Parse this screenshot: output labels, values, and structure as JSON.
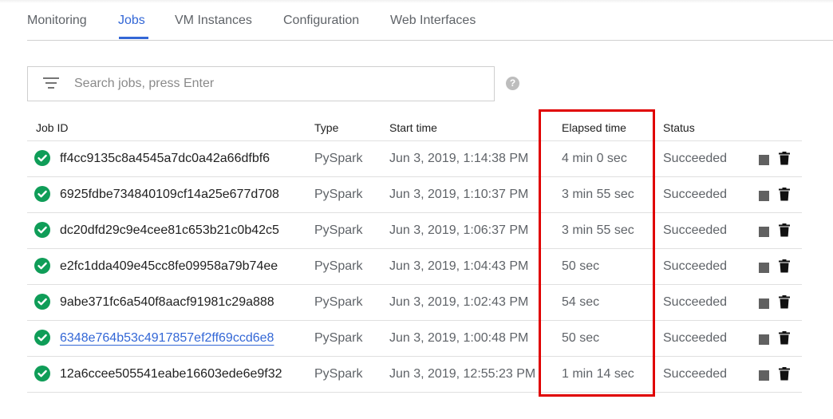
{
  "tabs": [
    {
      "label": "Monitoring",
      "active": false
    },
    {
      "label": "Jobs",
      "active": true
    },
    {
      "label": "VM Instances",
      "active": false
    },
    {
      "label": "Configuration",
      "active": false
    },
    {
      "label": "Web Interfaces",
      "active": false
    }
  ],
  "search": {
    "placeholder": "Search jobs, press Enter",
    "value": ""
  },
  "help_icon_glyph": "?",
  "columns": {
    "job_id": "Job ID",
    "type": "Type",
    "start_time": "Start time",
    "elapsed_time": "Elapsed time",
    "status": "Status"
  },
  "jobs": [
    {
      "id": "ff4cc9135c8a4545a7dc0a42a66dfbf6",
      "type": "PySpark",
      "start": "Jun 3, 2019, 1:14:38 PM",
      "elapsed": "4 min 0 sec",
      "status": "Succeeded"
    },
    {
      "id": "6925fdbe734840109cf14a25e677d708",
      "type": "PySpark",
      "start": "Jun 3, 2019, 1:10:37 PM",
      "elapsed": "3 min 55 sec",
      "status": "Succeeded"
    },
    {
      "id": "dc20dfd29c9e4cee81c653b21c0b42c5",
      "type": "PySpark",
      "start": "Jun 3, 2019, 1:06:37 PM",
      "elapsed": "3 min 55 sec",
      "status": "Succeeded"
    },
    {
      "id": "e2fc1dda409e45cc8fe09958a79b74ee",
      "type": "PySpark",
      "start": "Jun 3, 2019, 1:04:43 PM",
      "elapsed": "50 sec",
      "status": "Succeeded"
    },
    {
      "id": "9abe371fc6a540f8aacf91981c29a888",
      "type": "PySpark",
      "start": "Jun 3, 2019, 1:02:43 PM",
      "elapsed": "54 sec",
      "status": "Succeeded"
    },
    {
      "id": "6348e764b53c4917857ef2ff69ccd6e8",
      "type": "PySpark",
      "start": "Jun 3, 2019, 1:00:48 PM",
      "elapsed": "50 sec",
      "status": "Succeeded",
      "hovered_link": true
    },
    {
      "id": "12a6ccee505541eabe16603ede6e9f32",
      "type": "PySpark",
      "start": "Jun 3, 2019, 12:55:23 PM",
      "elapsed": "1 min 14 sec",
      "status": "Succeeded"
    }
  ],
  "colors": {
    "accent": "#3367d6",
    "success": "#0f9d58",
    "highlight": "#e00000"
  },
  "row_icons": [
    "check-circle-icon",
    "stop-icon",
    "trash-icon"
  ]
}
